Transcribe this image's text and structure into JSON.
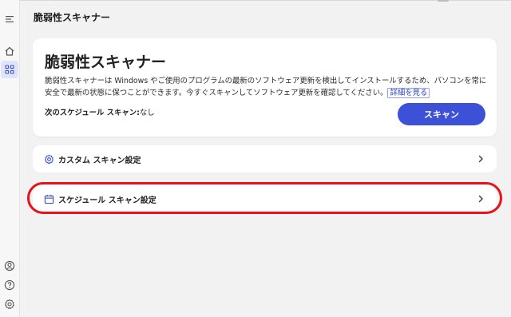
{
  "page": {
    "header_title": "脆弱性スキャナー"
  },
  "rail": {
    "top_icons": [
      "menu-icon",
      "home-icon",
      "apps-grid-icon"
    ],
    "bottom_icons": [
      "account-icon",
      "help-icon",
      "settings-icon"
    ],
    "active": "apps-grid-icon"
  },
  "hero": {
    "title": "脆弱性スキャナー",
    "description": "脆弱性スキャナーは Windows やご使用のプログラムの最新のソフトウェア更新を検出してインストールするため、パソコンを常に安全で最新の状態に保つことができます。今すぐスキャンしてソフトウェア更新を確認してください。",
    "link_label": "詳細を見る",
    "schedule_label": "次のスケジュール スキャン:",
    "schedule_value": "なし",
    "scan_button": "スキャン"
  },
  "rows": {
    "custom_scan": {
      "label": "カスタム スキャン設定",
      "icon": "gear-icon"
    },
    "schedule_scan": {
      "label": "スケジュール スキャン設定",
      "icon": "calendar-icon"
    }
  },
  "colors": {
    "accent": "#3c51d8",
    "highlight": "#e8121b",
    "background": "#f2f2f2",
    "card": "#ffffff"
  }
}
